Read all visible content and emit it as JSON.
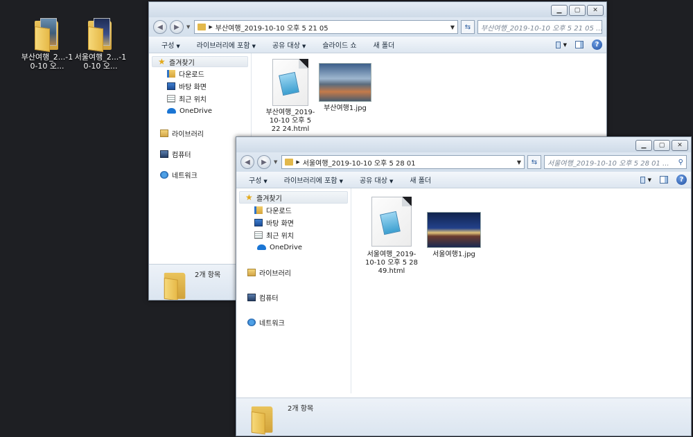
{
  "desktop": {
    "icons": [
      {
        "label": "부산여행_2...-10-10 오..."
      },
      {
        "label": "서울여행_2...-10-10 오..."
      }
    ]
  },
  "window_back": {
    "address": "부산여행_2019-10-10 오후 5 21 05",
    "search_placeholder": "부산여행_2019-10-10 오후 5 21 05 ...",
    "toolbar": {
      "organize": "구성",
      "include_library": "라이브러리에 포함",
      "share": "공유 대상",
      "slideshow": "슬라이드 쇼",
      "new_folder": "새 폴더"
    },
    "nav": {
      "favorites": "즐겨찾기",
      "downloads": "다운로드",
      "desktop": "바탕 화면",
      "recent": "최근 위치",
      "onedrive": "OneDrive",
      "libraries": "라이브러리",
      "computer": "컴퓨터",
      "network": "네트워크"
    },
    "files": [
      {
        "name": "부산여행_2019-10-10 오후 5 22 24.html",
        "type": "html"
      },
      {
        "name": "부산여행1.jpg",
        "type": "jpg"
      }
    ],
    "status": "2개 항목"
  },
  "window_front": {
    "address": "서울여행_2019-10-10 오후 5 28 01",
    "search_placeholder": "서울여행_2019-10-10 오후 5 28 01 ...",
    "toolbar": {
      "organize": "구성",
      "include_library": "라이브러리에 포함",
      "share": "공유 대상",
      "new_folder": "새 폴더"
    },
    "nav": {
      "favorites": "즐겨찾기",
      "downloads": "다운로드",
      "desktop": "바탕 화면",
      "recent": "최근 위치",
      "onedrive": "OneDrive",
      "libraries": "라이브러리",
      "computer": "컴퓨터",
      "network": "네트워크"
    },
    "files": [
      {
        "name": "서울여행_2019-10-10 오후 5 28 49.html",
        "type": "html"
      },
      {
        "name": "서울여행1.jpg",
        "type": "jpg"
      }
    ],
    "status": "2개 항목"
  },
  "icons": {
    "back": "back-arrow-icon",
    "forward": "forward-arrow-icon",
    "refresh": "refresh-icon",
    "search": "search-icon",
    "help": "help-icon"
  }
}
